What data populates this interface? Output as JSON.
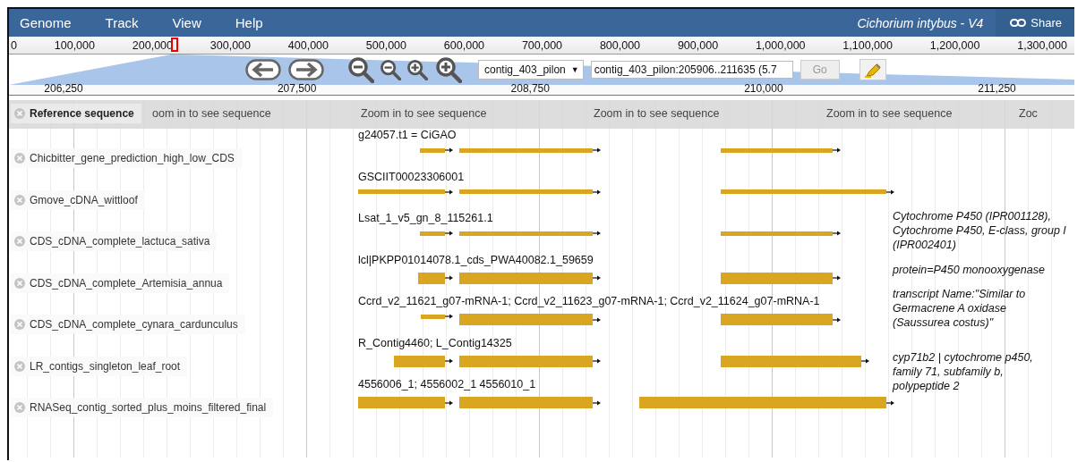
{
  "menu": [
    "Genome",
    "Track",
    "View",
    "Help"
  ],
  "title": "Cichorium intybus - V4",
  "share_button": "Share",
  "overview_ruler": [
    "0",
    "100,000",
    "200,000",
    "300,000",
    "400,000",
    "500,000",
    "600,000",
    "700,000",
    "800,000",
    "900,000",
    "1,000,000",
    "1,100,000",
    "1,200,000",
    "1,300,000"
  ],
  "navigation": {
    "reference_dropdown": "contig_403_pilon",
    "dropdown_caret": "▼",
    "location_field": "contig_403_pilon:205906..211635 (5.7",
    "go_button": {
      "label": "Go",
      "disabled": true
    }
  },
  "detail_ruler": [
    "206,250",
    "207,500",
    "208,750",
    "210,000",
    "211,250"
  ],
  "reference_track": {
    "label": "Reference sequence",
    "messages": [
      "oom in to see sequence",
      "Zoom in to see sequence",
      "Zoom in to see sequence",
      "Zoom in to see sequence",
      "Zoc"
    ]
  },
  "tracks": [
    {
      "label": "Chicbitter_gene_prediction_high_low_CDS",
      "feature_name": "g24057.t1 = CiGAO",
      "features": [
        {
          "kind": "thin"
        },
        {
          "kind": "thin"
        },
        {
          "kind": "thin"
        }
      ]
    },
    {
      "label": "Gmove_cDNA_wittloof",
      "feature_name": "GSCIIT00023306001",
      "features": [
        {
          "kind": "thin"
        },
        {
          "kind": "thin"
        },
        {
          "kind": "thin"
        }
      ]
    },
    {
      "label": "CDS_cDNA_complete_lactuca_sativa",
      "feature_name": "Lsat_1_v5_gn_8_115261.1",
      "features": [
        {
          "kind": "thin"
        },
        {
          "kind": "thin"
        },
        {
          "kind": "thin"
        }
      ]
    },
    {
      "label": "CDS_cDNA_complete_Artemisia_annua",
      "feature_name": "lcl|PKPP01014078.1_cds_PWA40082.1_59659",
      "features": [
        {
          "kind": "thick"
        },
        {
          "kind": "thick"
        },
        {
          "kind": "thick"
        }
      ]
    },
    {
      "label": "CDS_cDNA_complete_cynara_cardunculus",
      "feature_name": "Ccrd_v2_11621_g07-mRNA-1; Ccrd_v2_11623_g07-mRNA-1; Ccrd_v2_11624_g07-mRNA-1",
      "features": [
        {
          "kind": "thin"
        },
        {
          "kind": "thick"
        },
        {
          "kind": "thick"
        }
      ]
    },
    {
      "label": "LR_contigs_singleton_leaf_root",
      "feature_name": "R_Contig4460;  L_Contig14325",
      "features": [
        {
          "kind": "thick"
        },
        {
          "kind": "thick"
        },
        {
          "kind": "thick"
        }
      ]
    },
    {
      "label": "RNASeq_contig_sorted_plus_moins_filtered_final",
      "feature_name": "4556006_1; 4556002_1 4556010_1",
      "features": [
        {
          "kind": "thick"
        },
        {
          "kind": "thick"
        },
        {
          "kind": "thick"
        }
      ]
    }
  ],
  "notes": [
    [
      "Cytochrome P450 (IPR001128),",
      "Cytochrome P450, E-class, group I",
      "(IPR002401)"
    ],
    [
      "protein=P450 monooxygenase"
    ],
    [
      "transcript Name:\"Similar to",
      "Germacrene A oxidase",
      "(Saussurea costus)\""
    ],
    [
      "cyp71b2 | cytochrome p450,",
      "family 71, subfamily b,",
      "polypeptide 2"
    ]
  ]
}
